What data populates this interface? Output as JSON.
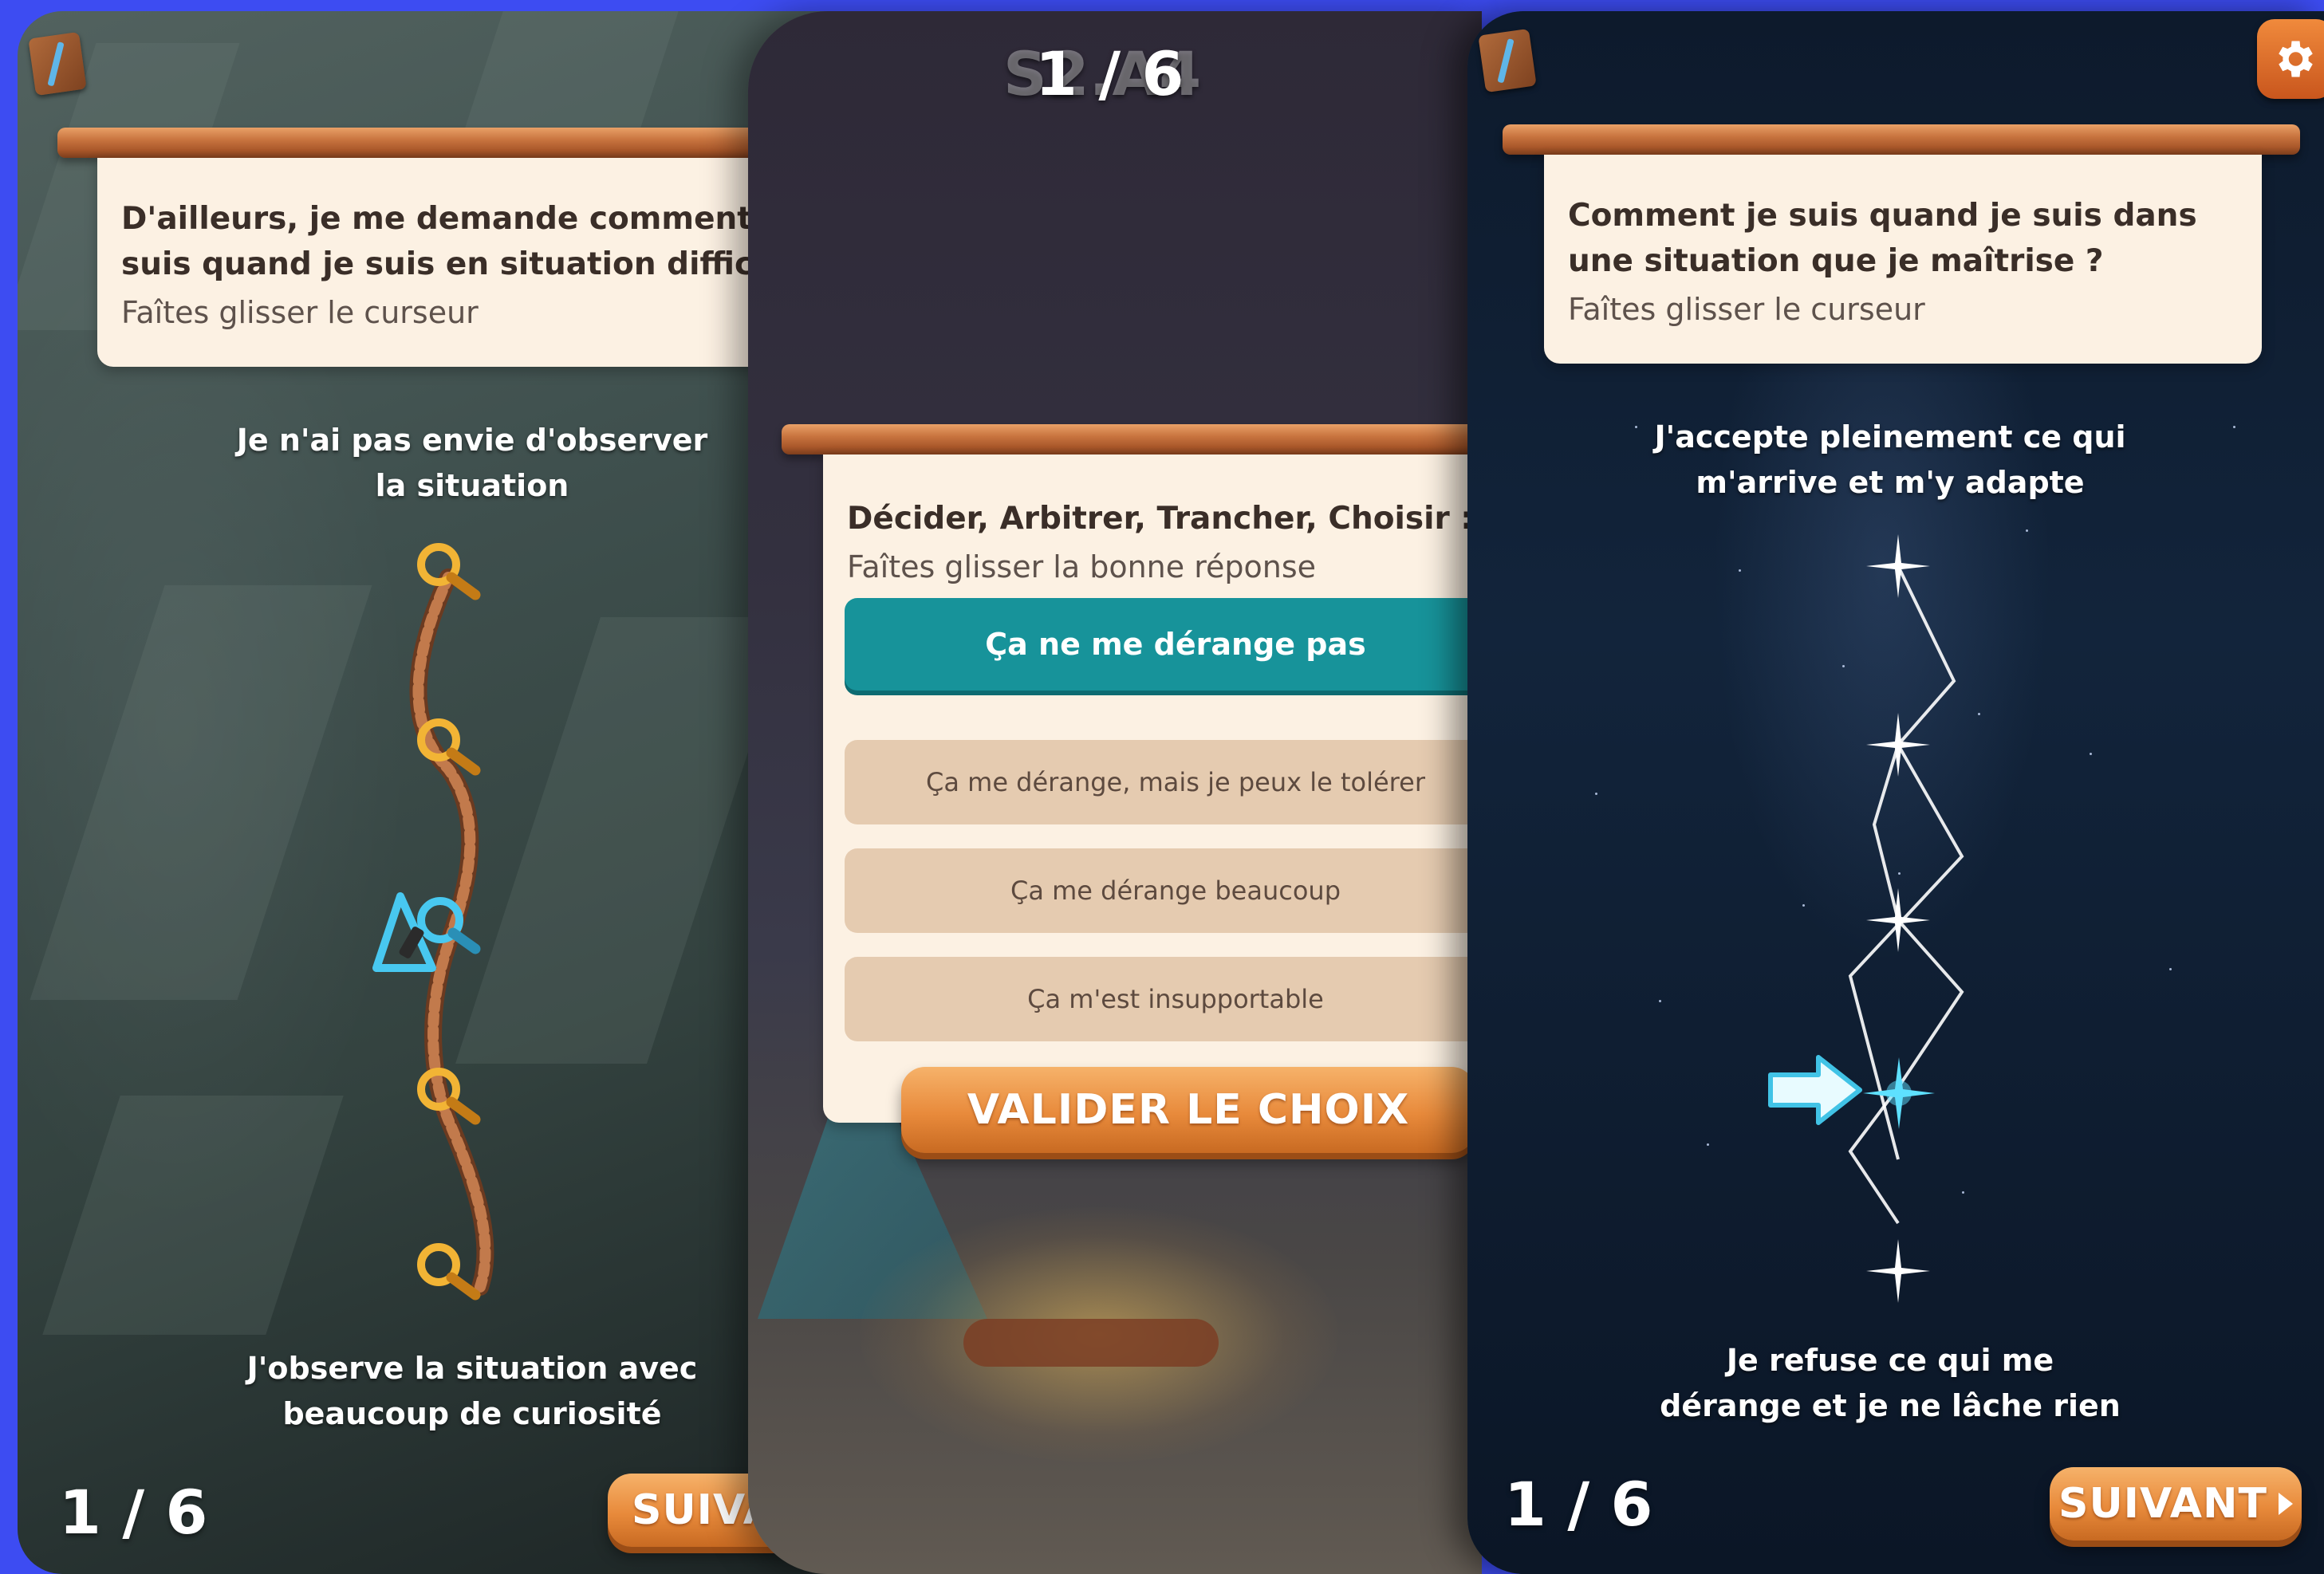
{
  "left_panel": {
    "question": "D'ailleurs, je me demande comment je suis quand je suis en situation difficile ?",
    "hint": "Faîtes glisser le curseur",
    "top_label": "Je n'ai pas envie d'observer la situation",
    "bottom_label": "J'observe la situation avec beaucoup de curiosité",
    "counter": "1 / 6",
    "next_button": "SUIVA",
    "slider_steps": 5,
    "slider_selected_step": 3,
    "icons": [
      "book-icon",
      "magnifier-icon",
      "carabiner-icon"
    ]
  },
  "middle_panel": {
    "counter": "1 / 6",
    "counter_ghost": "S2.A4",
    "question": "Décider, Arbitrer, Trancher, Choisir :",
    "hint": "Faîtes glisser la bonne réponse",
    "selected_option": "Ça ne me dérange pas",
    "options": [
      "Ça me dérange, mais je peux le tolérer",
      "Ça me dérange beaucoup",
      "Ça m'est insupportable"
    ],
    "validate_button": "VALIDER LE CHOIX",
    "icons": [
      "drag-handle-icon"
    ]
  },
  "right_panel": {
    "question": "Comment je suis quand je suis dans une situation que je maîtrise ?",
    "hint": "Faîtes glisser le curseur",
    "top_label": "J'accepte pleinement ce qui m'arrive et m'y adapte",
    "bottom_label": "Je refuse ce qui me dérange et je ne lâche rien",
    "counter": "1 / 6",
    "next_button": "SUIVANT",
    "slider_steps": 5,
    "slider_selected_step": 4,
    "icons": [
      "book-icon",
      "gear-icon",
      "star-icon",
      "arrow-right-icon"
    ]
  },
  "colors": {
    "background": "#3d4cf2",
    "selected_option": "#17939a",
    "option": "#e5cbb0",
    "card": "#fcf1e3",
    "button": "#e88a3b",
    "plank": "#c8743f"
  }
}
